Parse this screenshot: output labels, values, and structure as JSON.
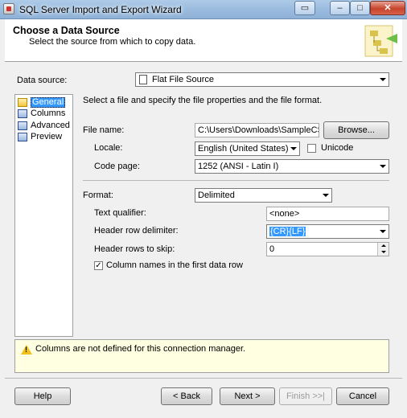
{
  "window": {
    "title": "SQL Server Import and Export Wizard",
    "min_glyph": "‒",
    "max_glyph": "□",
    "close_glyph": "✕",
    "restore_glyph": "▭"
  },
  "header": {
    "title": "Choose a Data Source",
    "subtitle": "Select the source from which to copy data."
  },
  "data_source": {
    "label": "Data source:",
    "value": "Flat File Source"
  },
  "nav": {
    "items": [
      {
        "label": "General",
        "icon": "general-icon",
        "selected": true
      },
      {
        "label": "Columns",
        "icon": "columns-icon",
        "selected": false
      },
      {
        "label": "Advanced",
        "icon": "advanced-icon",
        "selected": false
      },
      {
        "label": "Preview",
        "icon": "preview-icon",
        "selected": false
      }
    ]
  },
  "general": {
    "instruction": "Select a file and specify the file properties and the file format.",
    "file_name_label": "File name:",
    "file_name_value": "C:\\Users\\Downloads\\SampleCSVI",
    "browse_label": "Browse...",
    "locale_label": "Locale:",
    "locale_value": "English (United States)",
    "unicode_label": "Unicode",
    "code_page_label": "Code page:",
    "code_page_value": "1252  (ANSI - Latin I)",
    "format_label": "Format:",
    "format_value": "Delimited",
    "text_qualifier_label": "Text qualifier:",
    "text_qualifier_value": "<none>",
    "header_row_delimiter_label": "Header row delimiter:",
    "header_row_delimiter_value": "{CR}{LF}",
    "header_rows_skip_label": "Header rows to skip:",
    "header_rows_skip_value": "0",
    "column_names_label": "Column names in the first data row",
    "column_names_checked": "✓"
  },
  "warning": {
    "text": "Columns are not defined for this connection manager."
  },
  "footer": {
    "help": "Help",
    "back": "< Back",
    "next": "Next >",
    "finish": "Finish >>|",
    "cancel": "Cancel"
  },
  "colors": {
    "selection": "#3399ff",
    "warning_bg": "#ffffe1",
    "window_bg": "#f0f0f0"
  }
}
